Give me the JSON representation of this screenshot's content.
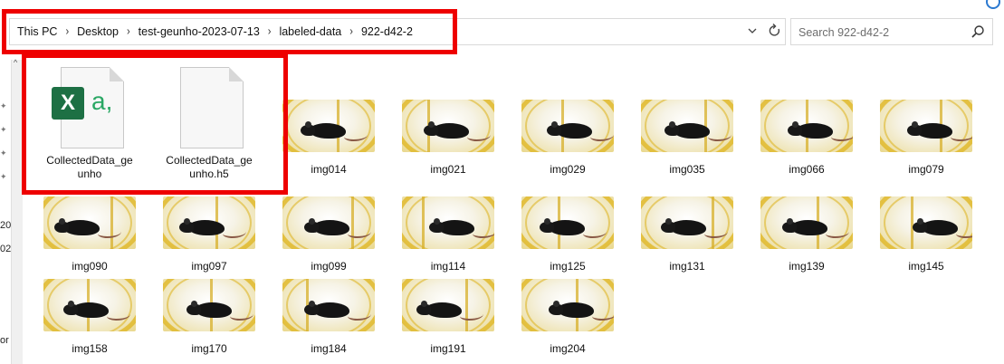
{
  "window": {
    "help_icon": "help-icon"
  },
  "address_bar": {
    "breadcrumb": [
      "This PC",
      "Desktop",
      "test-geunho-2023-07-13",
      "labeled-data",
      "922-d42-2"
    ],
    "separator": "›",
    "dropdown_icon": "chevron-down-icon",
    "refresh_icon": "refresh-icon"
  },
  "search": {
    "placeholder": "Search 922-d42-2",
    "value": "",
    "icon": "search-icon"
  },
  "highlight": {
    "color": "#ee0000"
  },
  "nav_pane": {
    "scroll_up": "^",
    "partial_labels": [
      "20",
      "02",
      "or"
    ]
  },
  "files": [
    {
      "name": "CollectedData_ge\nunho",
      "type": "excel"
    },
    {
      "name": "CollectedData_ge\nunho.h5",
      "type": "blank"
    },
    {
      "name": "img014",
      "type": "image"
    },
    {
      "name": "img021",
      "type": "image"
    },
    {
      "name": "img029",
      "type": "image"
    },
    {
      "name": "img035",
      "type": "image"
    },
    {
      "name": "img066",
      "type": "image"
    },
    {
      "name": "img079",
      "type": "image"
    },
    {
      "name": "img090",
      "type": "image"
    },
    {
      "name": "img097",
      "type": "image"
    },
    {
      "name": "img099",
      "type": "image"
    },
    {
      "name": "img114",
      "type": "image"
    },
    {
      "name": "img125",
      "type": "image"
    },
    {
      "name": "img131",
      "type": "image"
    },
    {
      "name": "img139",
      "type": "image"
    },
    {
      "name": "img145",
      "type": "image"
    },
    {
      "name": "img158",
      "type": "image"
    },
    {
      "name": "img170",
      "type": "image"
    },
    {
      "name": "img184",
      "type": "image"
    },
    {
      "name": "img191",
      "type": "image"
    },
    {
      "name": "img204",
      "type": "image"
    }
  ]
}
